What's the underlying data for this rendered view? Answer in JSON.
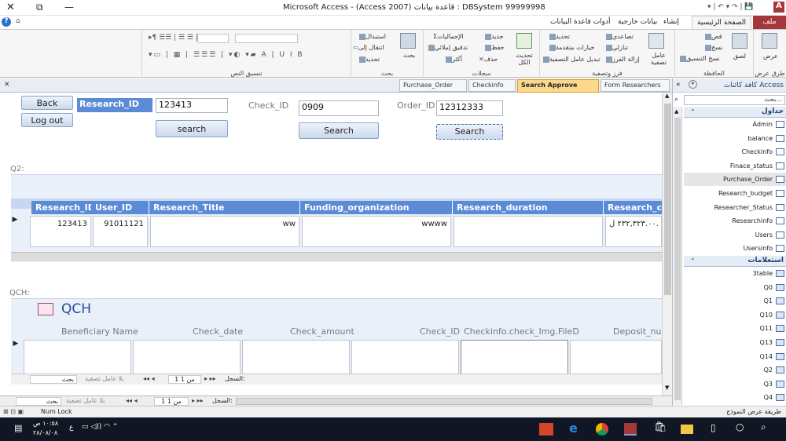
{
  "window": {
    "title": "Microsoft Access - (Access 2007) قاعدة بيانات : DBSystem 99999998",
    "min": "—",
    "restore": "⧉",
    "close": "✕"
  },
  "ribbon_tabs": [
    "ملف",
    "الصفحة الرئيسية",
    "إنشاء",
    "بيانات خارجية",
    "أدوات قاعدة البيانات"
  ],
  "ribbon": {
    "groups": [
      "طرق عرض",
      "الحافظة",
      "فرز وتصفية",
      "سجلات",
      "بحث",
      "تنسيق النص"
    ],
    "view_btn": "عرض",
    "paste_btn": "لصق",
    "clipboard": [
      "قص",
      "نسخ",
      "نسخ التنسيق"
    ],
    "filter_btn": "عامل تصفية",
    "sort": [
      "تصاعدي",
      "تنازلي",
      "إزالة الفرز"
    ],
    "filter_opts": [
      "تحديد",
      "خيارات متقدمة",
      "تبديل عامل التصفية"
    ],
    "refresh_btn": "تحديث الكل",
    "records": [
      "جديد",
      "حفظ",
      "حذف",
      "الإجماليات",
      "تدقيق إملائي",
      "أكثر"
    ],
    "find_btn": "بحث",
    "find_opts": [
      "استبدال",
      "انتقال إلى",
      "تحديد"
    ]
  },
  "doc_tabs": [
    "Form Researchers",
    "Search Approve",
    "Checkinfo",
    "Purchase_Order"
  ],
  "form": {
    "back": "Back",
    "logout": "Log out",
    "research_id_label": "Research_ID",
    "research_id_value": "123413",
    "search1": "search",
    "check_id_label": "Check_ID",
    "check_id_value": "0909",
    "search2": "Search",
    "order_id_label": "Order_ID",
    "order_id_value": "12312333",
    "search3": "Search",
    "q2_label": "Q2:",
    "q2_headers": [
      "Research_ID",
      "User_ID",
      "Research_Title",
      "Funding_organization",
      "Research_duration",
      "Research_co"
    ],
    "q2_row": [
      "123413",
      "91011121",
      "ww",
      "wwww",
      "",
      "٢٣٢,٣٢٣.٠٠ ل."
    ],
    "qch_label": "QCH:",
    "qch_title": "QCH",
    "qch_headers": [
      "Beneficiary Name",
      "Check_date",
      "Check_amount",
      "Check_ID",
      "Checkinfo.check_Img.FileD",
      "Deposit_num"
    ],
    "nav_inner": {
      "record": "السجل:",
      "pos": "1 من 1",
      "nofilter": "بلا عامل تصفية",
      "search": "بحث"
    },
    "nav_outer": {
      "record": "السجل:",
      "pos": "1 من 1",
      "nofilter": "بلا عامل تصفية",
      "search": "بحث"
    }
  },
  "navpane": {
    "title": "كافة كائنات Access",
    "search_placeholder": "بحث...",
    "tables_header": "جداول",
    "tables": [
      "Admin",
      "balance",
      "Checkinfo",
      "Finace_status",
      "Purchase_Order",
      "Research_budget",
      "Researcher_Status",
      "Researchinfo",
      "Users",
      "Usersinfo"
    ],
    "queries_header": "استعلامات",
    "queries": [
      "3table",
      "Q0",
      "Q1",
      "Q10",
      "Q11",
      "Q13",
      "Q14",
      "Q2",
      "Q3",
      "Q4"
    ]
  },
  "status": {
    "left": "طريقة عرض النموذج",
    "numlock": "Num Lock"
  },
  "taskbar": {
    "time": "١٠:٥٨ ص",
    "date": "٢٨/٠٨/٠٨",
    "lang": "ع"
  },
  "colors": {
    "accent": "#5b8ad6",
    "access": "#a4373a"
  }
}
